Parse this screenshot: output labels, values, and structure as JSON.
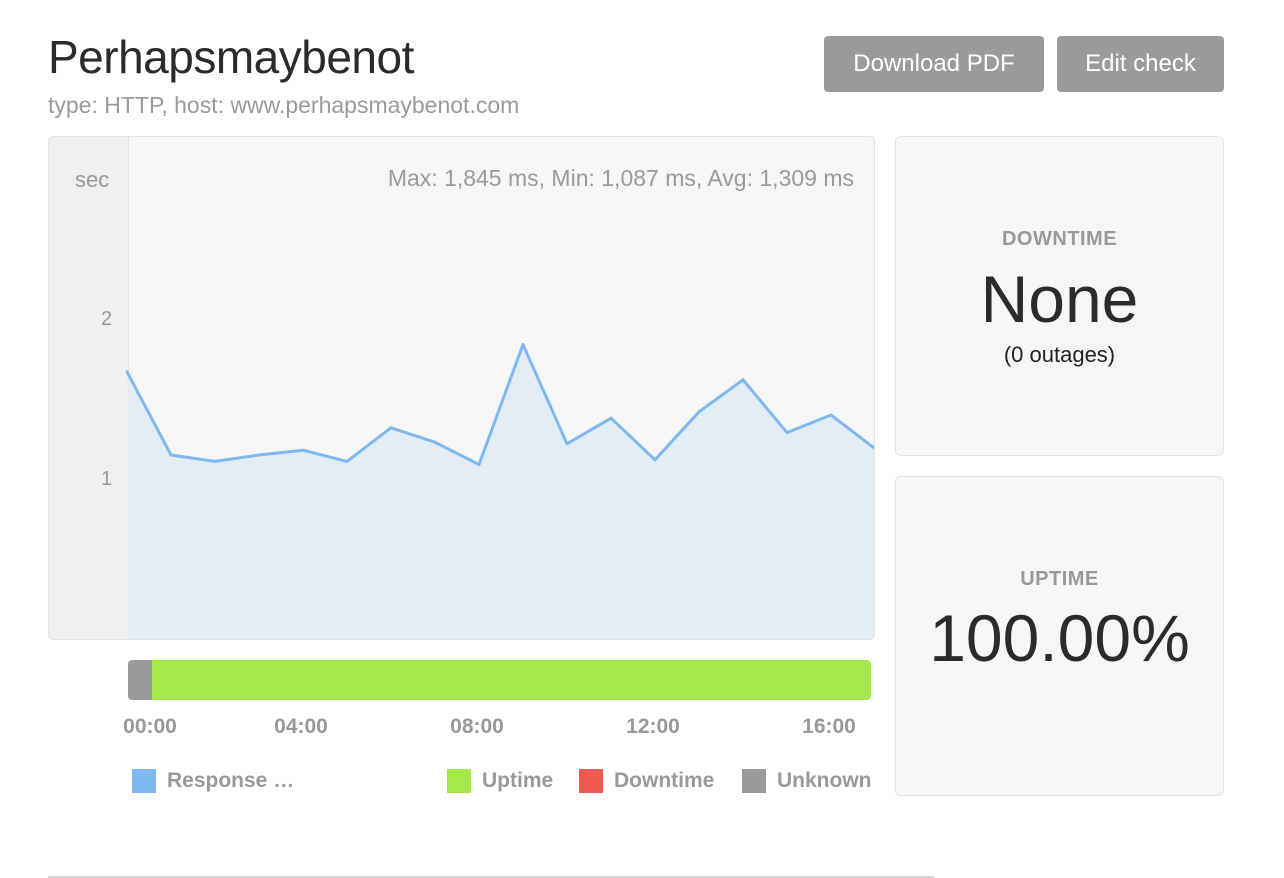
{
  "header": {
    "title": "Perhapsmaybenot",
    "subtitle": "type: HTTP, host: www.perhapsmaybenot.com",
    "download_label": "Download PDF",
    "edit_label": "Edit check"
  },
  "chart": {
    "stats": "Max: 1,845 ms, Min: 1,087 ms, Avg: 1,309 ms",
    "y_unit": "sec",
    "y_ticks": [
      "2",
      "1"
    ],
    "x_ticks": [
      "00:00",
      "04:00",
      "08:00",
      "12:00",
      "16:00"
    ],
    "legend": {
      "response": "Response …",
      "uptime": "Uptime",
      "downtime": "Downtime",
      "unknown": "Unknown"
    }
  },
  "chart_data": {
    "type": "area",
    "series": [
      {
        "name": "Response …",
        "values": [
          1.67,
          1.15,
          1.11,
          1.15,
          1.18,
          1.11,
          1.32,
          1.23,
          1.09,
          1.84,
          1.22,
          1.38,
          1.12,
          1.42,
          1.62,
          1.29,
          1.4,
          1.19
        ]
      }
    ],
    "x": [
      0,
      1,
      2,
      3,
      4,
      5,
      6,
      7,
      8,
      9,
      10,
      11,
      12,
      13,
      14,
      15,
      16,
      17
    ],
    "ylim": [
      0,
      3
    ],
    "y_ticks": [
      1,
      2
    ],
    "unknown_fraction": 0.032,
    "uptime_fraction": 0.968
  },
  "downtime": {
    "label": "DOWNTIME",
    "value": "None",
    "outages": "(0 outages)"
  },
  "uptime": {
    "label": "UPTIME",
    "value": "100.00%"
  },
  "colors": {
    "response": "#7fb9ef",
    "uptime": "#a6e84a",
    "downtime": "#ef5a50",
    "unknown": "#9b9b9b"
  }
}
